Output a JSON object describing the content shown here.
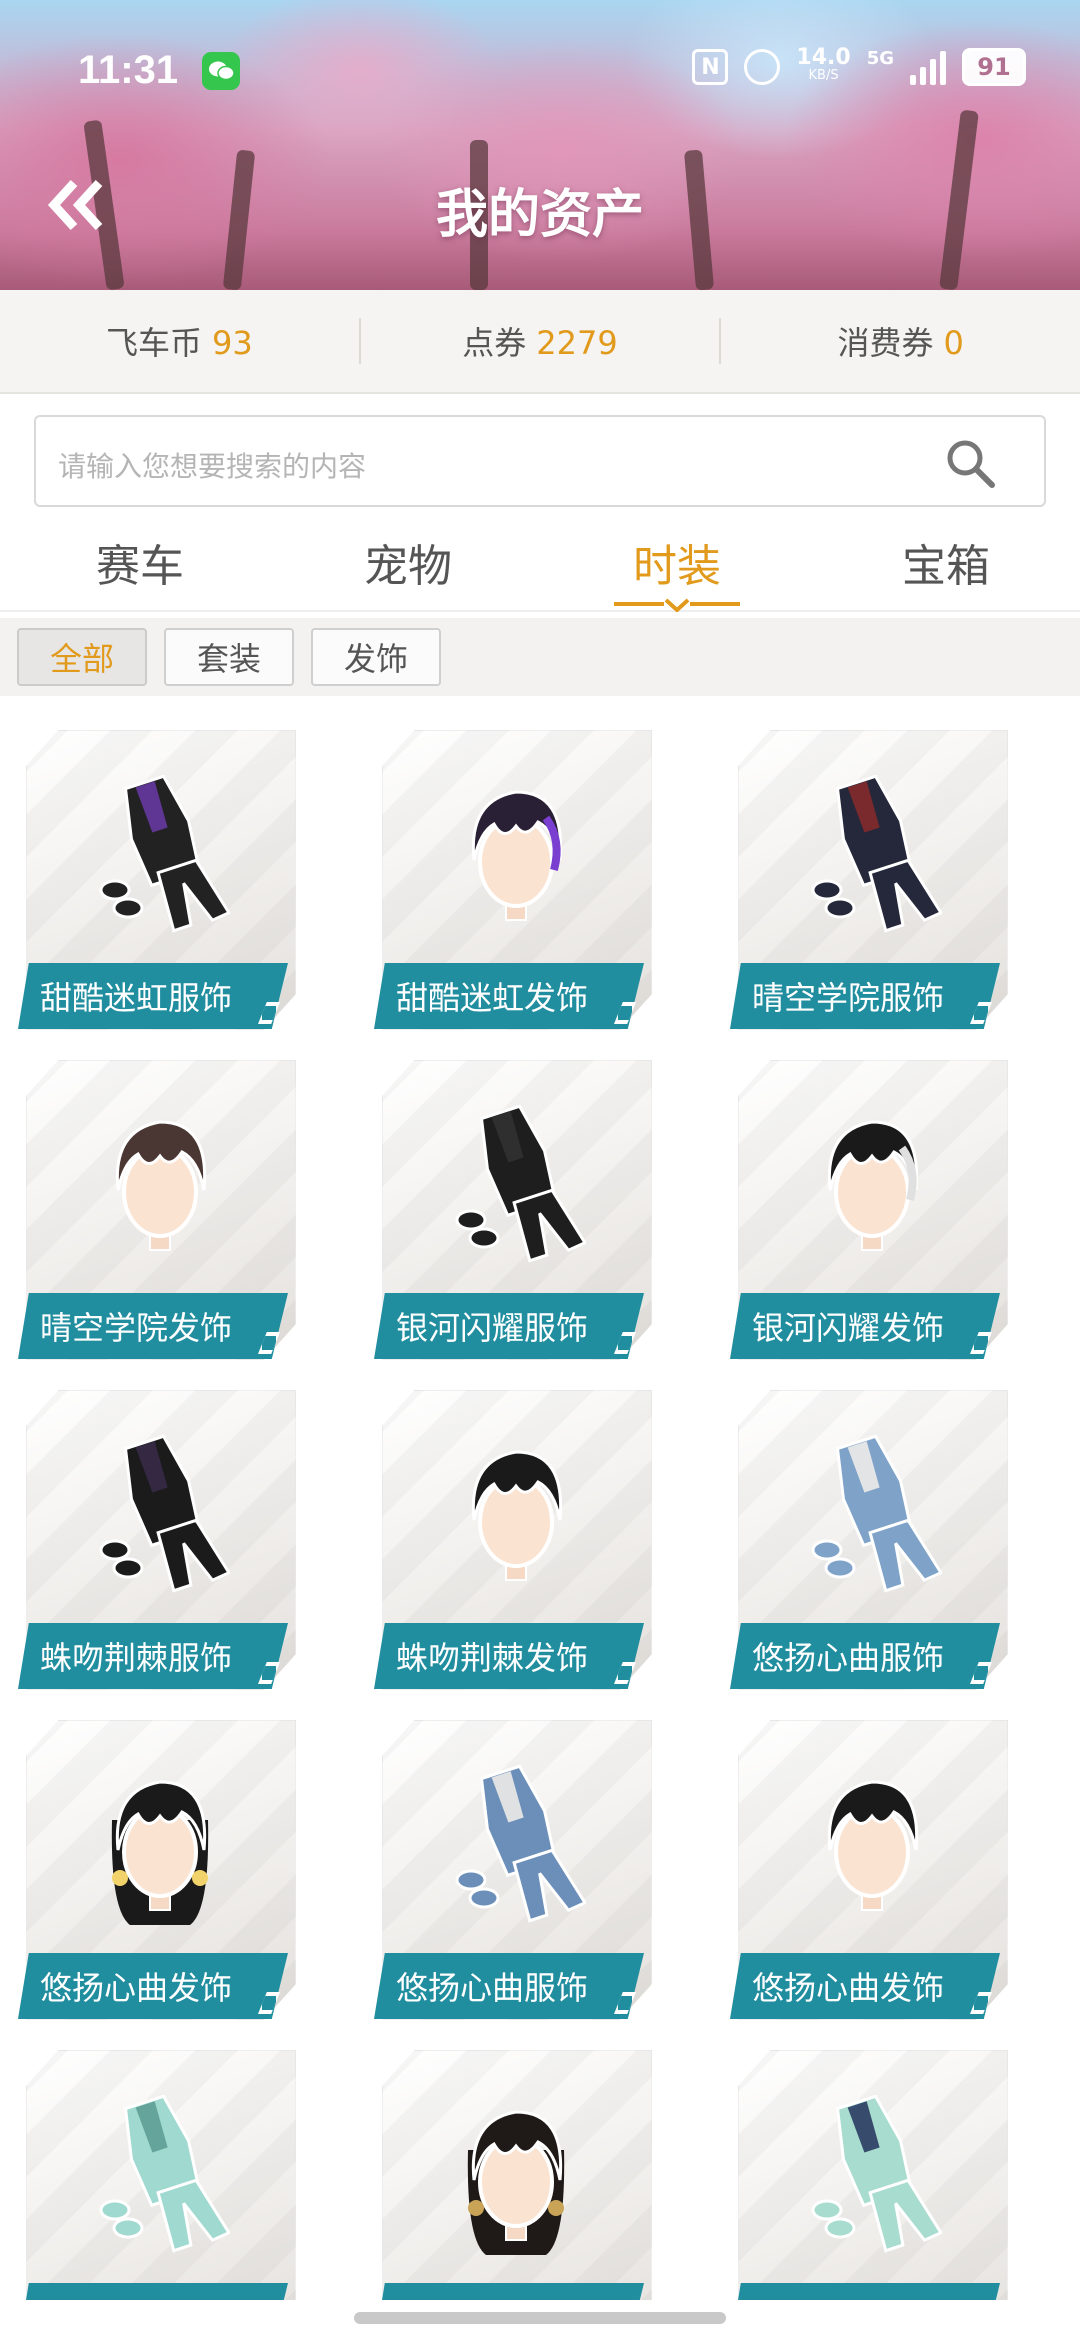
{
  "status_bar": {
    "time": "11:31",
    "speed_value": "14.0",
    "speed_unit": "KB/S",
    "network": "5G",
    "battery": "91"
  },
  "header": {
    "title": "我的资产"
  },
  "currency": [
    {
      "label": "飞车币",
      "value": "93"
    },
    {
      "label": "点券",
      "value": "2279"
    },
    {
      "label": "消费券",
      "value": "0"
    }
  ],
  "search": {
    "placeholder": "请输入您想要搜索的内容"
  },
  "tabs": [
    {
      "label": "赛车"
    },
    {
      "label": "宠物"
    },
    {
      "label": "时装"
    },
    {
      "label": "宝箱"
    }
  ],
  "active_tab": "时装",
  "filters": [
    {
      "label": "全部"
    },
    {
      "label": "套装"
    },
    {
      "label": "发饰"
    }
  ],
  "items": [
    {
      "name": "甜酷迷虹服饰",
      "kind": "outfit",
      "color": "#222222",
      "accent": "#6b3aa8"
    },
    {
      "name": "甜酷迷虹发饰",
      "kind": "hair",
      "color": "#2a2035",
      "accent": "#7a3fd0"
    },
    {
      "name": "晴空学院服饰",
      "kind": "outfit",
      "color": "#24283a",
      "accent": "#8a2a2a"
    },
    {
      "name": "晴空学院发饰",
      "kind": "hair",
      "color": "#4a3733",
      "accent": "#4a3733"
    },
    {
      "name": "银河闪耀服饰",
      "kind": "outfit",
      "color": "#1e1e1e",
      "accent": "#333333"
    },
    {
      "name": "银河闪耀发饰",
      "kind": "hair",
      "color": "#1a1a1a",
      "accent": "#e0e0e0"
    },
    {
      "name": "蛛吻荆棘服饰",
      "kind": "outfit",
      "color": "#1b1b1b",
      "accent": "#3a2a4a"
    },
    {
      "name": "蛛吻荆棘发饰",
      "kind": "hair",
      "color": "#1a1a1a",
      "accent": "#1a1a1a"
    },
    {
      "name": "悠扬心曲服饰",
      "kind": "outfit",
      "color": "#7fa2c8",
      "accent": "#f4f0ea"
    },
    {
      "name": "悠扬心曲发饰",
      "kind": "hair-long",
      "color": "#1a1a1a",
      "accent": "#f2d36b"
    },
    {
      "name": "悠扬心曲服饰",
      "kind": "outfit",
      "color": "#6c8fba",
      "accent": "#f4f0ea"
    },
    {
      "name": "悠扬心曲发饰",
      "kind": "hair",
      "color": "#1a1a1a",
      "accent": "#1a1a1a"
    },
    {
      "name": "",
      "kind": "outfit",
      "color": "#9fd9cf",
      "accent": "#5a9a90"
    },
    {
      "name": "",
      "kind": "hair-long",
      "color": "#1f1a17",
      "accent": "#c9a456"
    },
    {
      "name": "",
      "kind": "outfit",
      "color": "#a8dccf",
      "accent": "#23335a"
    }
  ],
  "colors": {
    "accent_orange": "#e19a1c",
    "label_teal": "#218ea0"
  }
}
